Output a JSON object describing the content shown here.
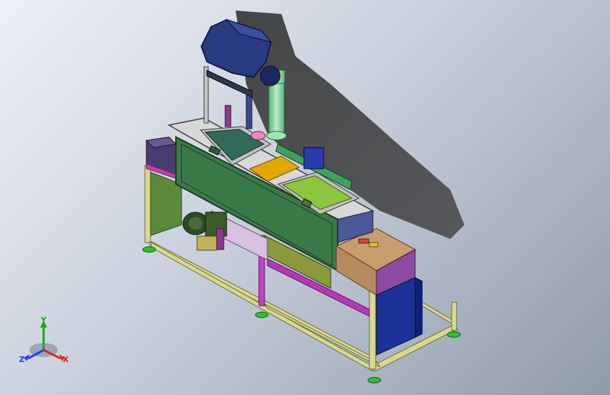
{
  "viewport": {
    "triad": {
      "y_label": "Y",
      "x_label": "X",
      "z_label": "Z",
      "colors": {
        "x": "#e02020",
        "y": "#18a818",
        "z": "#2040e0"
      }
    }
  },
  "colors": {
    "frame": "#d8d890",
    "tank_body": "#3a7a48",
    "tank_edge": "#1e3a22",
    "tank1_liquid": "#2f6a5a",
    "tank2_liquid": "#8cc63e",
    "divider": "#e2a700",
    "exhaust_hood": "#283a80",
    "duct": "#90e0a8",
    "motor": "#2c4a28",
    "control_box_top": "#c89e6e",
    "control_box_side": "#8e4aa0",
    "electrical_cabinet": "#1c3296",
    "left_panel": "#4a3c70",
    "lower_cover": "#5a8a3a",
    "leveling_foot": "#30c030",
    "drain_tray": "#b43ab4"
  }
}
